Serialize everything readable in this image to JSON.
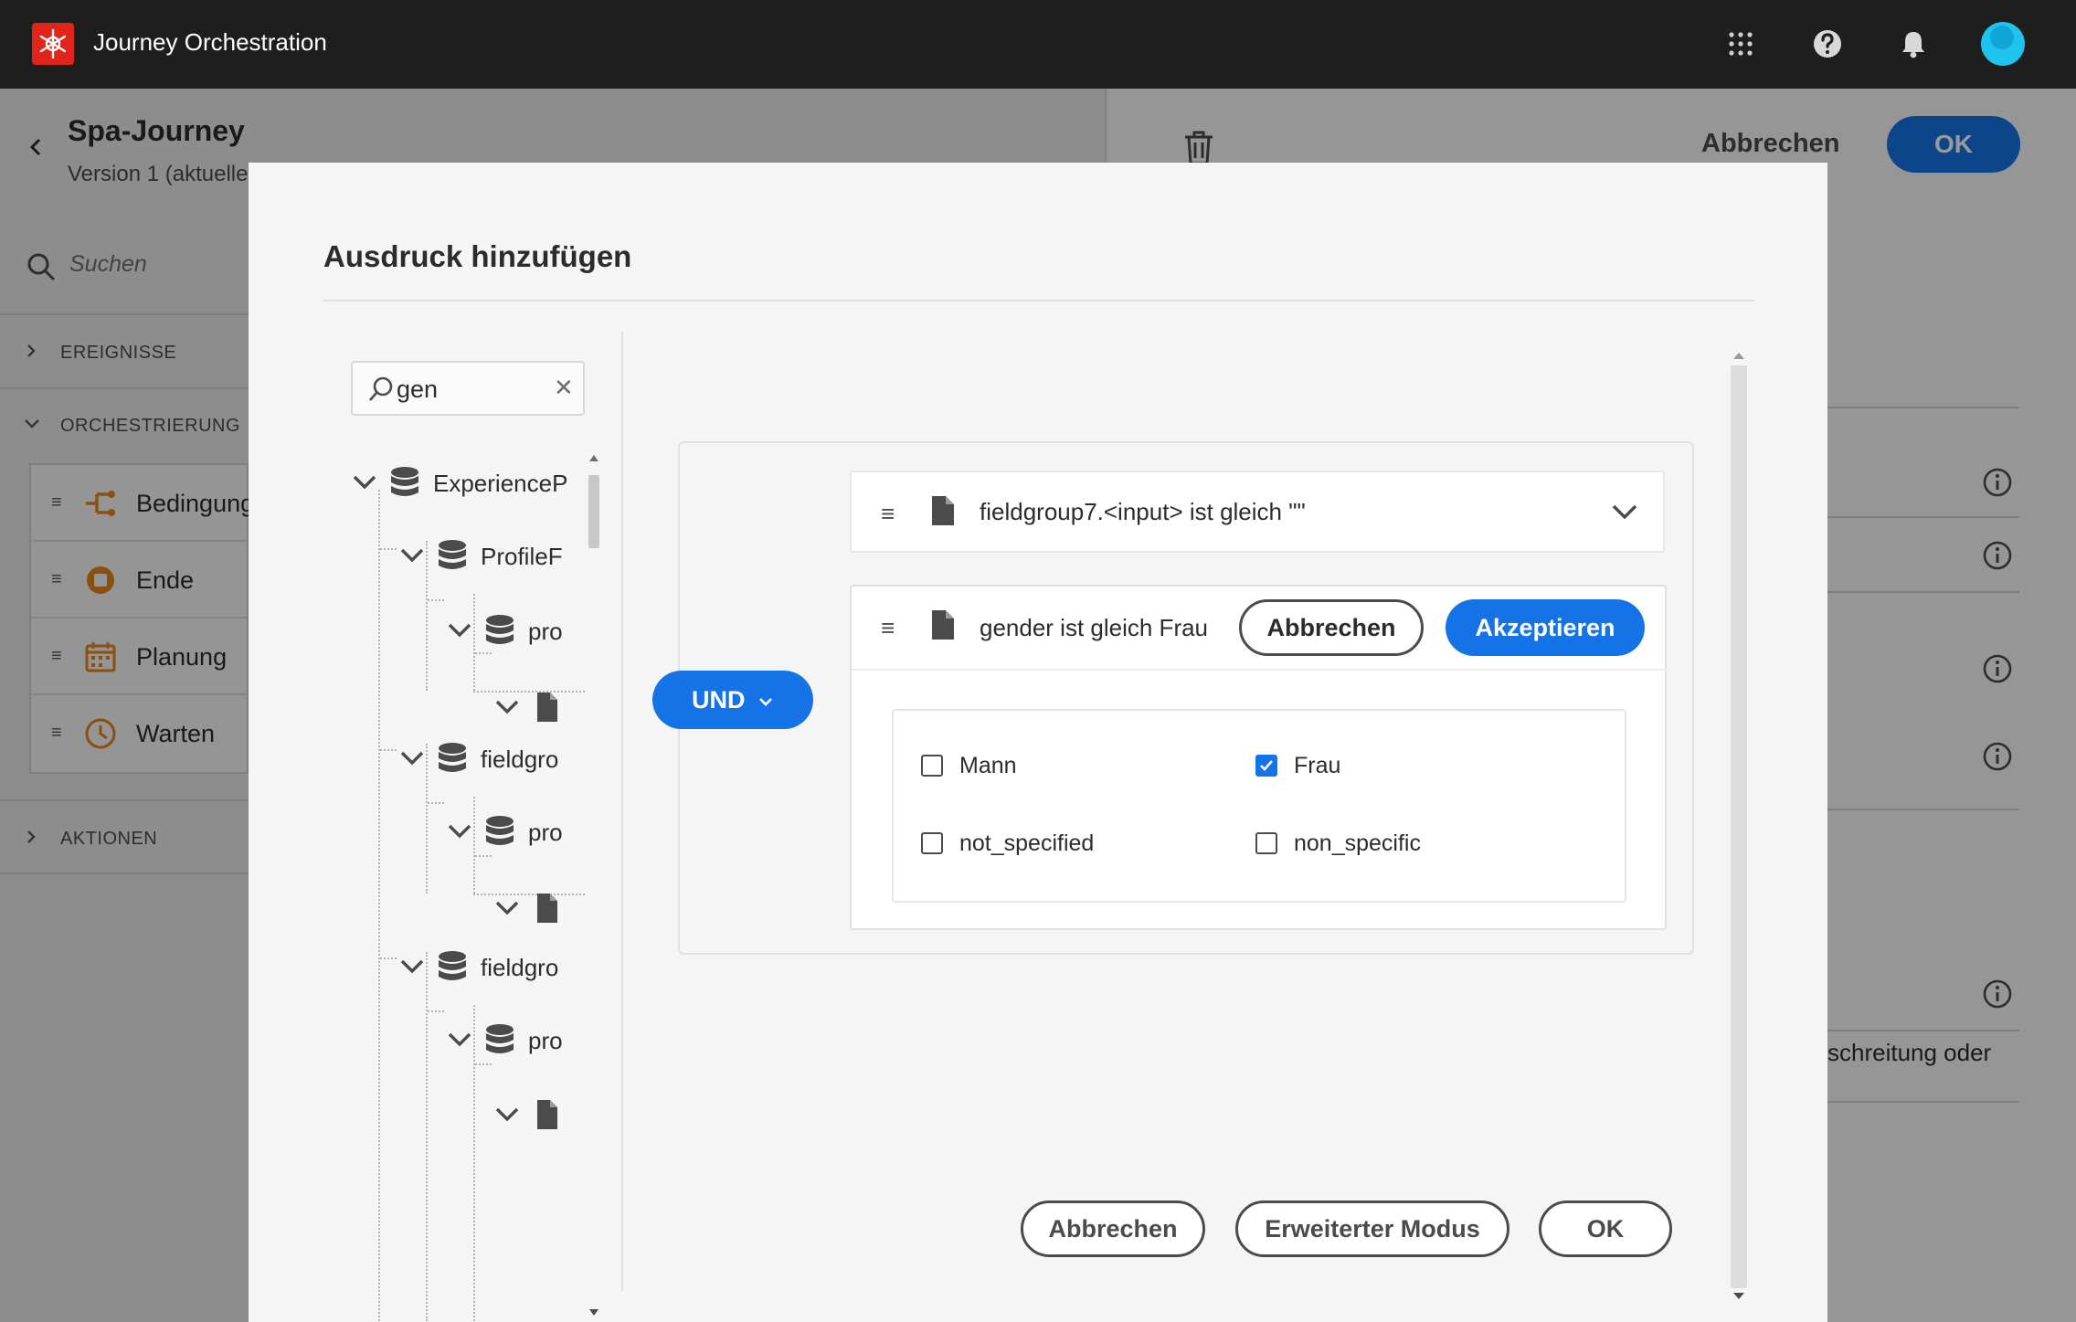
{
  "topbar": {
    "app_title": "Journey Orchestration",
    "icons": [
      "apps-grid-icon",
      "help-icon",
      "notifications-bell-icon",
      "user-avatar"
    ]
  },
  "journey": {
    "name": "Spa-Journey",
    "version": "Version 1 (aktuelle"
  },
  "left_panel": {
    "search_placeholder": "Suchen",
    "sections": {
      "events": "EREIGNISSE",
      "orchestration": "ORCHESTRIERUNG",
      "actions": "AKTIONEN"
    },
    "activities": [
      {
        "label": "Bedingung",
        "icon": "condition-icon"
      },
      {
        "label": "Ende",
        "icon": "end-icon"
      },
      {
        "label": "Planung",
        "icon": "calendar-icon"
      },
      {
        "label": "Warten",
        "icon": "clock-icon"
      }
    ]
  },
  "right_panel": {
    "cancel_label": "Abbrechen",
    "ok_label": "OK",
    "partial_text": "schreitung oder"
  },
  "modal": {
    "title": "Ausdruck hinzufügen",
    "tree_search_value": "gen",
    "tree": [
      {
        "label": "ExperienceP",
        "icon": "database-icon"
      },
      {
        "label": "ProfileF",
        "icon": "database-icon"
      },
      {
        "label": "pro",
        "icon": "database-icon"
      },
      {
        "label": "",
        "icon": "document-icon"
      },
      {
        "label": "fieldgro",
        "icon": "database-icon"
      },
      {
        "label": "pro",
        "icon": "database-icon"
      },
      {
        "label": "",
        "icon": "document-icon"
      },
      {
        "label": "fieldgro",
        "icon": "database-icon"
      },
      {
        "label": "pro",
        "icon": "database-icon"
      },
      {
        "label": "",
        "icon": "document-icon"
      }
    ],
    "operator_label": "UND",
    "condition1": "fieldgroup7.<input> ist gleich \"\"",
    "condition2": {
      "text": "gender ist gleich Frau",
      "cancel_label": "Abbrechen",
      "accept_label": "Akzeptieren",
      "options": [
        {
          "label": "Mann",
          "checked": false
        },
        {
          "label": "Frau",
          "checked": true
        },
        {
          "label": "not_specified",
          "checked": false
        },
        {
          "label": "non_specific",
          "checked": false
        }
      ]
    },
    "footer": {
      "cancel_label": "Abbrechen",
      "advanced_label": "Erweiterter Modus",
      "ok_label": "OK"
    }
  },
  "colors": {
    "accent": "#1473e6",
    "topbar": "#1e1e1e",
    "brand_logo": "#e1251b",
    "activity_icon": "#e68619"
  }
}
